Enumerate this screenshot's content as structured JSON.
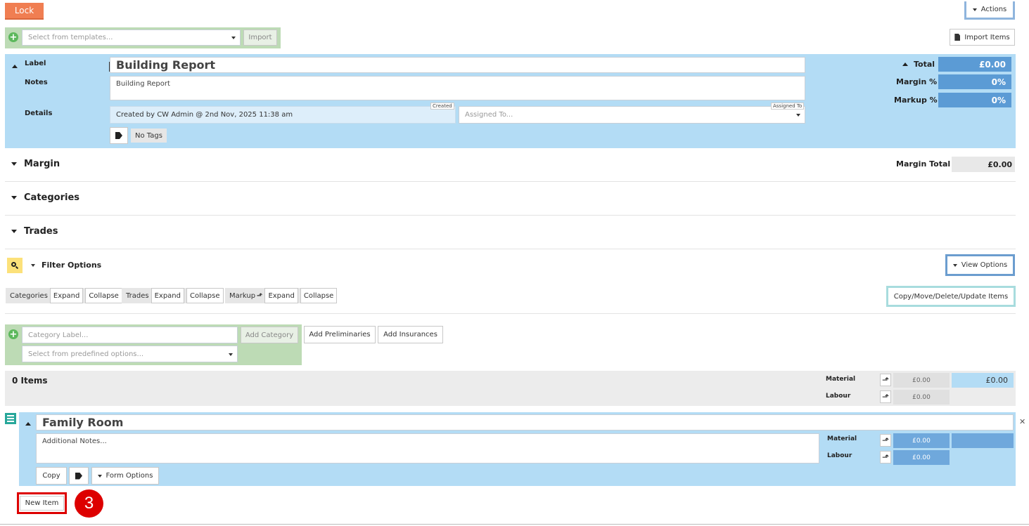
{
  "toolbar": {
    "lock_label": "Lock",
    "actions_label": "Actions",
    "import_items_label": "Import Items"
  },
  "templates": {
    "placeholder": "Select from templates...",
    "import_label": "Import"
  },
  "header": {
    "label_caption": "Label",
    "title": "Building Report",
    "notes_caption": "Notes",
    "notes_value": "Building Report",
    "details_caption": "Details",
    "created_tag": "Created",
    "created_value": "Created by  CW Admin @ 2nd Nov, 2025 11:38 am",
    "assigned_tag": "Assigned To",
    "assigned_placeholder": "Assigned To...",
    "no_tags_label": "No Tags"
  },
  "totals": {
    "total_label": "Total",
    "total_value": "£0.00",
    "margin_pct_label": "Margin %",
    "margin_pct_value": "0%",
    "markup_pct_label": "Markup %",
    "markup_pct_value": "0%"
  },
  "sections": {
    "margin": "Margin",
    "margin_total_label": "Margin Total",
    "margin_total_value": "£0.00",
    "categories": "Categories",
    "trades": "Trades",
    "filter_options": "Filter Options",
    "view_options": "View Options"
  },
  "toggles": {
    "categories": "Categories",
    "trades": "Trades",
    "markup": "Markup",
    "expand": "Expand",
    "collapse": "Collapse",
    "copy_move": "Copy/Move/Delete/Update Items"
  },
  "add_category": {
    "label_placeholder": "Category Label...",
    "add_label": "Add Category",
    "predefined_placeholder": "Select from predefined options...",
    "add_preliminaries": "Add Preliminaries",
    "add_insurances": "Add Insurances"
  },
  "summary": {
    "items_count": "0 Items",
    "material_label": "Material",
    "labour_label": "Labour",
    "material_value": "£0.00",
    "labour_value": "£0.00",
    "material_total": "£0.00"
  },
  "category": {
    "title": "Family Room",
    "notes_placeholder": "Additional Notes...",
    "material_label": "Material",
    "labour_label": "Labour",
    "material_value": "£0.00",
    "labour_value": "£0.00",
    "copy_label": "Copy",
    "form_options_label": "Form Options"
  },
  "new_item_label": "New Item",
  "step_number": "3",
  "colors": {
    "lock": "#f07e52",
    "header_bg": "#b3dcf5",
    "value_blue": "#5b9bd5",
    "green_panel": "#bddbb5",
    "highlight_red": "#dd0000"
  }
}
